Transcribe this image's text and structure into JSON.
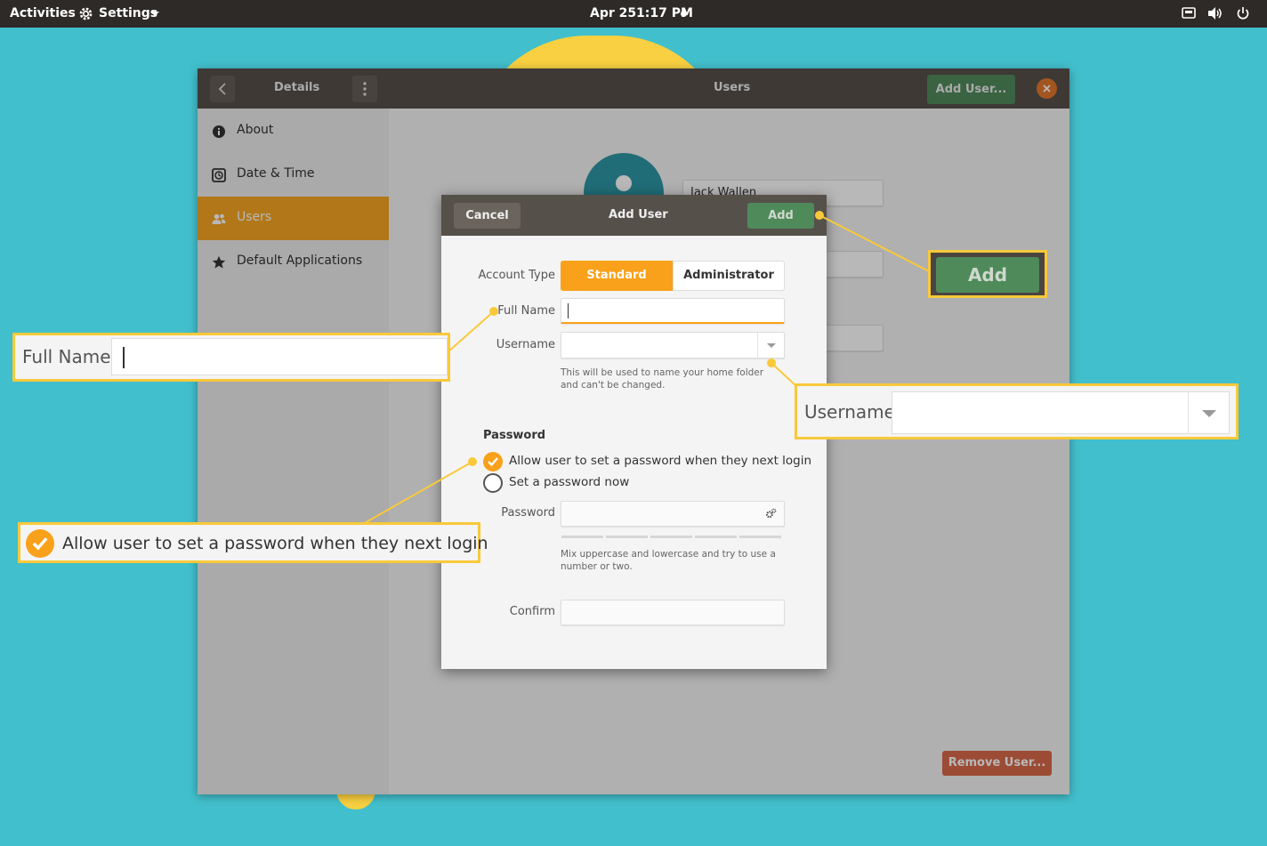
{
  "topbar": {
    "activities": "Activities",
    "app_menu": "Settings",
    "clock_date": "Apr 25",
    "clock_time": "1:17 PM"
  },
  "window": {
    "back_icon": "chevron-left-icon",
    "panel_title": "Details",
    "menu_icon": "vertical-dots-icon",
    "title": "Users",
    "add_user_button": "Add User...",
    "close_icon": "close-icon",
    "sidebar": [
      {
        "label": "About",
        "icon": "info-icon"
      },
      {
        "label": "Date & Time",
        "icon": "clock-icon"
      },
      {
        "label": "Users",
        "icon": "users-icon",
        "selected": true
      },
      {
        "label": "Default Applications",
        "icon": "star-icon"
      }
    ],
    "user_name_value": "Jack Wallen",
    "remove_user_button": "Remove User..."
  },
  "dialog": {
    "cancel": "Cancel",
    "title": "Add User",
    "add": "Add",
    "account_type_label": "Account Type",
    "account_types": [
      "Standard",
      "Administrator"
    ],
    "account_type_selected": "Standard",
    "full_name_label": "Full Name",
    "full_name_value": "",
    "username_label": "Username",
    "username_value": "",
    "username_hint": "This will be used to name your home folder and can't be changed.",
    "password_heading": "Password",
    "option_next_login": "Allow user to set a password when they next login",
    "option_set_now": "Set a password now",
    "option_next_login_checked": true,
    "password_label": "Password",
    "password_value": "",
    "password_hint": "Mix uppercase and lowercase and try to use a number or two.",
    "confirm_label": "Confirm",
    "confirm_value": ""
  },
  "callouts": {
    "add": "Add",
    "full_name": "Full Name",
    "username": "Username",
    "next_login": "Allow user to set a password when they next login"
  },
  "colors": {
    "desktop": "#42bfcc",
    "accent_orange": "#f9a11b",
    "add_green": "#4f8a5a",
    "callout_yellow": "#f9c93a",
    "selected_sidebar": "#f5a623",
    "remove_red": "#d9694a"
  }
}
